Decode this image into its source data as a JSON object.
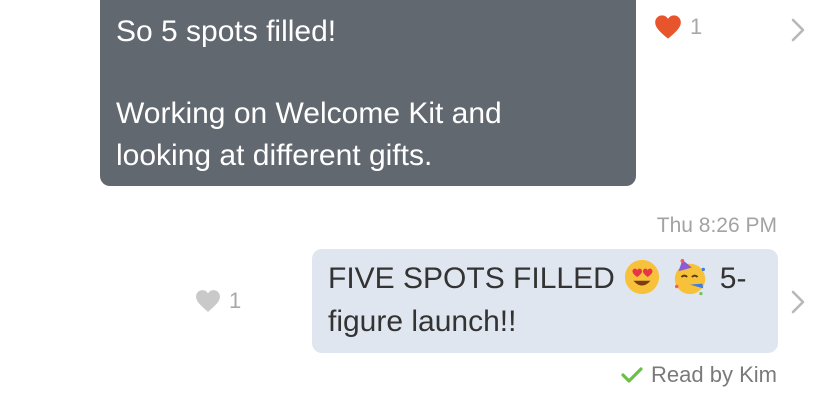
{
  "incoming_message": {
    "line1": "So 5 spots filled!",
    "line2": "Working on Welcome Kit and",
    "line3": "looking at different gifts.",
    "like_count": "1",
    "like_icon": "heart-filled-red",
    "like_color": "#e8542b"
  },
  "outgoing_message": {
    "timestamp": "Thu 8:26 PM",
    "text_before": "FIVE SPOTS FILLED",
    "emoji_1": "heart-eyes-emoji",
    "emoji_2": "party-face-emoji",
    "text_after": "5-",
    "text_line2": "figure launch!!",
    "like_count": "1",
    "like_icon": "heart-outline-gray",
    "read_receipt": "Read by Kim",
    "check_color": "#6cc04a"
  },
  "colors": {
    "incoming_bubble": "#626870",
    "outgoing_bubble": "#e0e6ef"
  }
}
